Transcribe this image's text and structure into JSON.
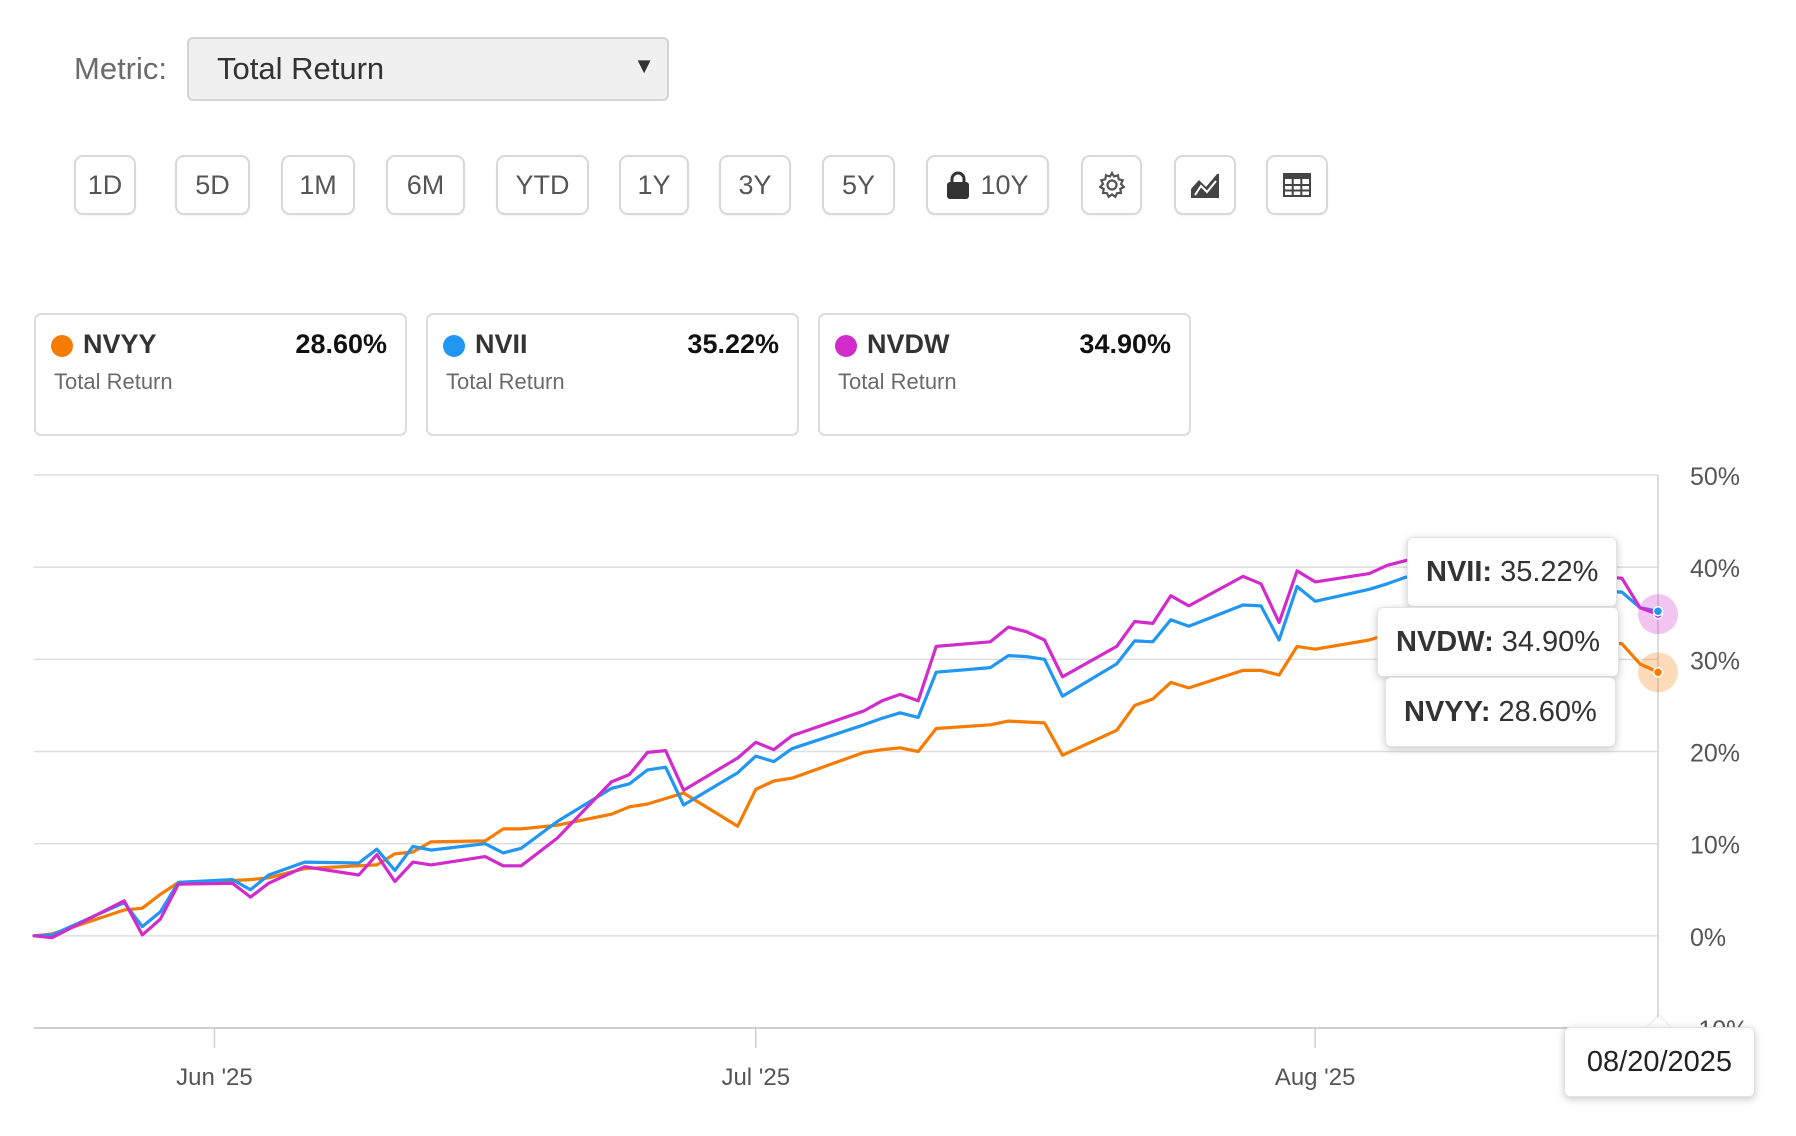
{
  "metric": {
    "label": "Metric:",
    "selected": "Total Return"
  },
  "ranges": [
    "1D",
    "5D",
    "1M",
    "6M",
    "YTD",
    "1Y",
    "3Y",
    "5Y",
    "10Y"
  ],
  "range_icons": [
    "lock-icon",
    "gear-icon",
    "chart-type-icon",
    "table-icon"
  ],
  "cards": [
    {
      "ticker": "NVYY",
      "value": "28.60%",
      "sub": "Total Return",
      "color": "#F57C00"
    },
    {
      "ticker": "NVII",
      "value": "35.22%",
      "sub": "Total Return",
      "color": "#2196F3"
    },
    {
      "ticker": "NVDW",
      "value": "34.90%",
      "sub": "Total Return",
      "color": "#D12BCB"
    }
  ],
  "tooltips": [
    {
      "ticker": "NVII:",
      "value": "35.22%"
    },
    {
      "ticker": "NVDW:",
      "value": "34.90%"
    },
    {
      "ticker": "NVYY:",
      "value": "28.60%"
    }
  ],
  "hover_date": "08/20/2025",
  "chart_data": {
    "type": "line",
    "x_tick_labels": [
      "Jun '25",
      "Jul '25",
      "Aug '25"
    ],
    "y_tick_labels": [
      "50%",
      "40%",
      "30%",
      "20%",
      "10%",
      "0%",
      "-10%"
    ],
    "ylim": [
      -10,
      50
    ],
    "y_unit": "%",
    "grid": true,
    "x": [
      "2025-05-22",
      "2025-05-23",
      "2025-05-27",
      "2025-05-28",
      "2025-05-29",
      "2025-05-30",
      "2025-06-02",
      "2025-06-03",
      "2025-06-04",
      "2025-06-05",
      "2025-06-06",
      "2025-06-09",
      "2025-06-10",
      "2025-06-11",
      "2025-06-12",
      "2025-06-13",
      "2025-06-16",
      "2025-06-17",
      "2025-06-18",
      "2025-06-20",
      "2025-06-23",
      "2025-06-24",
      "2025-06-25",
      "2025-06-26",
      "2025-06-27",
      "2025-06-30",
      "2025-07-01",
      "2025-07-02",
      "2025-07-03",
      "2025-07-07",
      "2025-07-08",
      "2025-07-09",
      "2025-07-10",
      "2025-07-11",
      "2025-07-14",
      "2025-07-15",
      "2025-07-16",
      "2025-07-17",
      "2025-07-18",
      "2025-07-21",
      "2025-07-22",
      "2025-07-23",
      "2025-07-24",
      "2025-07-25",
      "2025-07-28",
      "2025-07-29",
      "2025-07-30",
      "2025-07-31",
      "2025-08-01",
      "2025-08-04",
      "2025-08-05",
      "2025-08-06",
      "2025-08-07",
      "2025-08-08",
      "2025-08-11",
      "2025-08-12",
      "2025-08-13",
      "2025-08-14",
      "2025-08-15",
      "2025-08-18",
      "2025-08-19",
      "2025-08-20"
    ],
    "series": [
      {
        "name": "NVYY",
        "color": "#F57C00",
        "values": [
          0.0,
          0.2,
          2.8,
          3.0,
          4.5,
          5.8,
          6.0,
          6.1,
          6.3,
          6.8,
          7.3,
          7.6,
          7.7,
          8.9,
          9.1,
          10.2,
          10.3,
          11.6,
          11.6,
          12.0,
          13.2,
          14.0,
          14.3,
          14.9,
          15.5,
          11.9,
          15.9,
          16.8,
          17.1,
          19.9,
          20.2,
          20.4,
          20.0,
          22.5,
          22.9,
          23.3,
          23.2,
          23.1,
          19.6,
          22.3,
          25.0,
          25.7,
          27.5,
          26.9,
          28.8,
          28.8,
          28.3,
          31.4,
          31.1,
          32.1,
          32.7,
          33.0,
          33.4,
          33.8,
          34.0,
          33.3,
          33.6,
          34.0,
          32.0,
          31.7,
          29.5,
          28.6
        ]
      },
      {
        "name": "NVII",
        "color": "#2196F3",
        "values": [
          0.0,
          0.1,
          3.6,
          1.0,
          2.6,
          5.8,
          6.1,
          5.0,
          6.6,
          7.3,
          8.0,
          7.9,
          9.4,
          7.1,
          9.7,
          9.3,
          10.0,
          9.0,
          9.5,
          12.4,
          16.0,
          16.5,
          18.0,
          18.3,
          14.2,
          17.7,
          19.5,
          18.9,
          20.3,
          22.9,
          23.6,
          24.2,
          23.7,
          28.6,
          29.1,
          30.4,
          30.3,
          30.0,
          26.0,
          29.5,
          32.0,
          31.9,
          34.3,
          33.6,
          35.9,
          35.8,
          32.1,
          37.9,
          36.3,
          37.6,
          38.2,
          38.9,
          39.2,
          39.8,
          40.1,
          39.2,
          39.6,
          40.1,
          37.6,
          37.3,
          35.6,
          35.22
        ]
      },
      {
        "name": "NVDW",
        "color": "#D12BCB",
        "values": [
          0.0,
          -0.2,
          3.8,
          0.1,
          1.8,
          5.6,
          5.7,
          4.2,
          5.7,
          6.6,
          7.5,
          6.6,
          8.8,
          5.9,
          8.0,
          7.7,
          8.6,
          7.6,
          7.6,
          10.6,
          16.7,
          17.5,
          19.9,
          20.1,
          15.8,
          19.3,
          21.0,
          20.2,
          21.7,
          24.4,
          25.5,
          26.2,
          25.5,
          31.4,
          31.9,
          33.5,
          33.0,
          32.1,
          28.1,
          31.4,
          34.1,
          33.9,
          36.9,
          35.8,
          39.0,
          38.2,
          34.0,
          39.6,
          38.4,
          39.3,
          40.2,
          40.7,
          41.2,
          41.8,
          42.1,
          41.3,
          41.7,
          42.3,
          39.2,
          38.8,
          35.6,
          34.9
        ]
      }
    ]
  }
}
